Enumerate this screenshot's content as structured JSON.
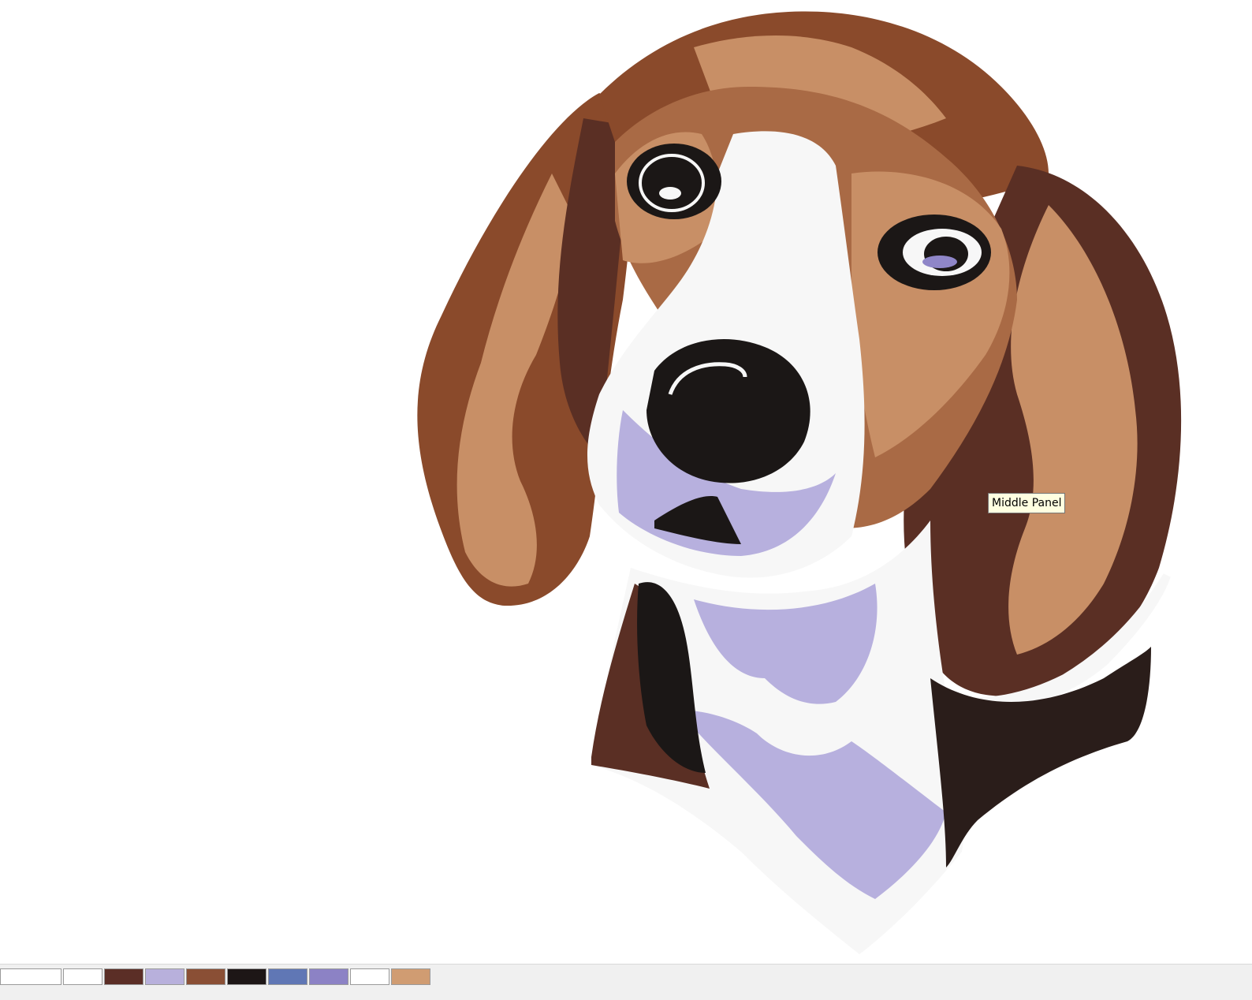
{
  "tooltip": {
    "text": "Middle Panel"
  },
  "design": {
    "icon": "beagle-embroidery-design",
    "colors": {
      "dark_brown": "#5a2f24",
      "mid_brown": "#8a4a2b",
      "tan": "#c88f66",
      "light_tan": "#d9a57c",
      "white": "#f7f7f7",
      "lavender": "#b7b0de",
      "black": "#1b1716",
      "blue": "#6379b8",
      "periwinkle": "#8f86c8"
    }
  },
  "palette": {
    "swatches": [
      {
        "name": "swatch-blank",
        "color": "#ffffff"
      },
      {
        "name": "swatch-white",
        "color": "#ffffff"
      },
      {
        "name": "swatch-dark-brown",
        "color": "#5b2e26"
      },
      {
        "name": "swatch-lavender",
        "color": "#b8b0dc"
      },
      {
        "name": "swatch-brown",
        "color": "#8a4f35"
      },
      {
        "name": "swatch-black",
        "color": "#1d1616"
      },
      {
        "name": "swatch-blue",
        "color": "#6077b5"
      },
      {
        "name": "swatch-periwinkle",
        "color": "#8c82c5"
      },
      {
        "name": "swatch-white-2",
        "color": "#ffffff"
      },
      {
        "name": "swatch-tan",
        "color": "#d09c72"
      }
    ]
  }
}
